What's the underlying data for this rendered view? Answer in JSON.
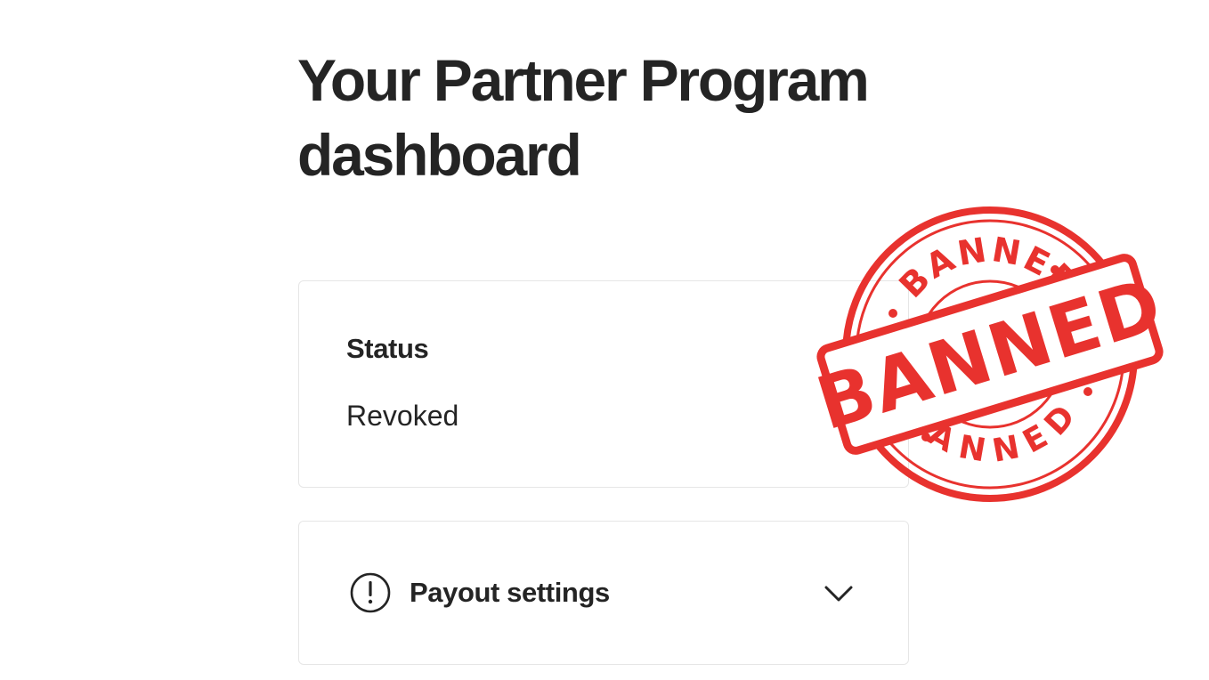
{
  "page": {
    "title": "Your Partner Program dashboard"
  },
  "status_card": {
    "heading": "Status",
    "value": "Revoked",
    "expand_icon": "chevron-down-icon"
  },
  "payout_card": {
    "label": "Payout settings",
    "alert_icon": "exclamation-circle-icon",
    "expand_icon": "chevron-down-icon"
  },
  "stamp": {
    "arc_top": "BANNED",
    "center": "BANNED",
    "arc_bottom": "BANNED",
    "color": "#e8322e"
  },
  "colors": {
    "text": "#242424",
    "card_border": "#e6e6e6",
    "background": "#ffffff",
    "stamp_red": "#e8322e"
  }
}
